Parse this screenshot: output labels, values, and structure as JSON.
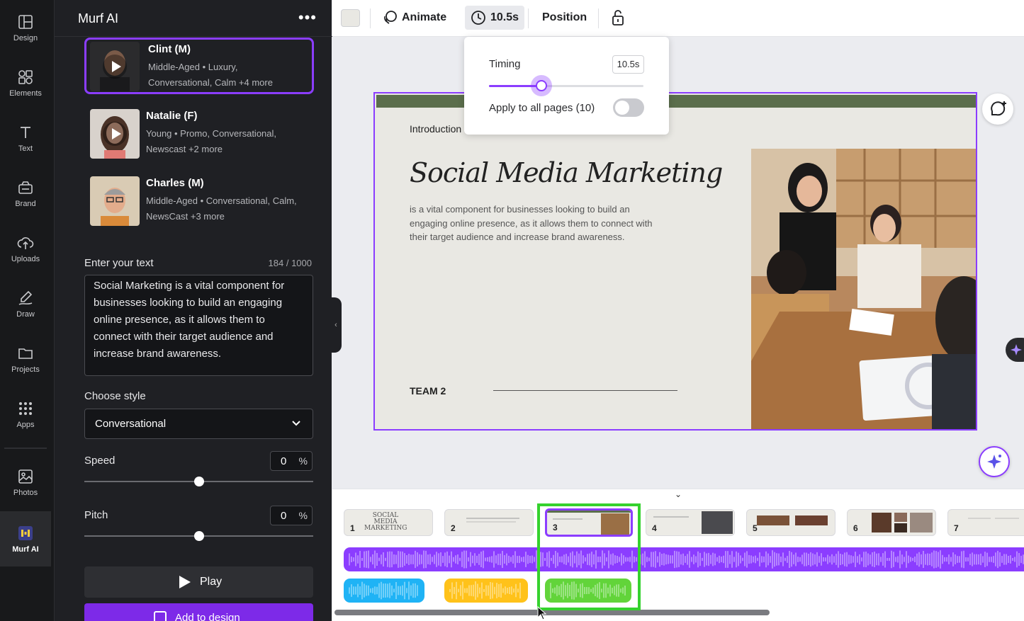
{
  "rail": {
    "items": [
      {
        "label": "Design",
        "icon": "design-icon"
      },
      {
        "label": "Elements",
        "icon": "elements-icon"
      },
      {
        "label": "Text",
        "icon": "text-icon"
      },
      {
        "label": "Brand",
        "icon": "brand-icon"
      },
      {
        "label": "Uploads",
        "icon": "uploads-icon"
      },
      {
        "label": "Draw",
        "icon": "draw-icon"
      },
      {
        "label": "Projects",
        "icon": "folder-icon"
      },
      {
        "label": "Apps",
        "icon": "apps-grid-icon"
      },
      {
        "label": "Photos",
        "icon": "photos-icon"
      },
      {
        "label": "Murf AI",
        "icon": "murf-logo-icon"
      }
    ]
  },
  "panel": {
    "title": "Murf AI",
    "more": "•••",
    "voices": [
      {
        "name": "Clint (M)",
        "desc": "Middle-Aged • Luxury, Conversational, Calm +4 more"
      },
      {
        "name": "Natalie (F)",
        "desc": "Young • Promo, Conversational, Newscast +2 more"
      },
      {
        "name": "Charles (M)",
        "desc": "Middle-Aged • Conversational, Calm, NewsCast +3 more"
      }
    ],
    "text_label": "Enter your text",
    "counter": "184 / 1000",
    "text_value": "Social Marketing is a vital component for businesses looking to build an engaging online presence, as it allows them to connect with their target audience and increase brand awareness.",
    "style_label": "Choose style",
    "style_value": "Conversational",
    "speed_label": "Speed",
    "speed_value": "0",
    "speed_level": 0.5,
    "pitch_label": "Pitch",
    "pitch_value": "0",
    "pitch_level": 0.5,
    "percent": "%",
    "play_label": "Play",
    "add_label": "Add to design"
  },
  "toolbar": {
    "animate_label": "Animate",
    "duration_label": "10.5s",
    "position_label": "Position"
  },
  "timing": {
    "title": "Timing",
    "value": "10.5s",
    "level": 0.34,
    "apply_label": "Apply to all pages (10)",
    "apply_on": false
  },
  "slide": {
    "intro": "Introduction",
    "title": "Social Media Marketing",
    "body": "is a vital component for businesses looking to build an engaging online presence, as it allows them to connect with their target audience and increase brand awareness.",
    "team": "TEAM 2"
  },
  "timeline": {
    "pages": [
      {
        "num": "1",
        "text": "SOCIAL MEDIA MARKETING"
      },
      {
        "num": "2",
        "text": ""
      },
      {
        "num": "3",
        "text": ""
      },
      {
        "num": "4",
        "text": ""
      },
      {
        "num": "5",
        "text": ""
      },
      {
        "num": "6",
        "text": ""
      },
      {
        "num": "7",
        "text": ""
      }
    ],
    "selected_page": "3"
  },
  "colors": {
    "accent": "#8b3dff",
    "wave_main": "#8b3dff",
    "wave_blue": "#1fb3f5",
    "wave_yellow": "#ffc21a",
    "wave_green": "#62d43a",
    "highlight": "#35d22e"
  }
}
